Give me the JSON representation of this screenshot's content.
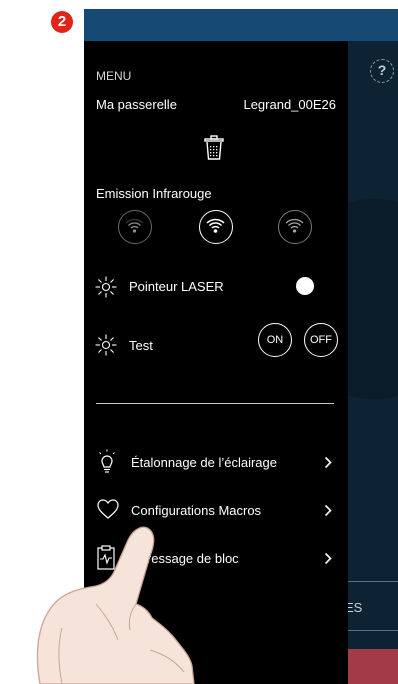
{
  "step_badge": "2",
  "background": {
    "help_symbol": "?",
    "button_partial_label": "ES"
  },
  "menu": {
    "title": "MENU",
    "gateway_label": "Ma passerelle",
    "gateway_value": "Legrand_00E26",
    "trash_icon": "trash-icon",
    "ir": {
      "label": "Emission Infrarouge",
      "levels": [
        "wifi-low-icon",
        "wifi-selected-icon",
        "wifi-high-icon"
      ],
      "selected_index": 1
    },
    "laser": {
      "label": "Pointeur LASER",
      "icon": "laser-sun-icon"
    },
    "test": {
      "label": "Test",
      "on_label": "ON",
      "off_label": "OFF"
    },
    "items": [
      {
        "label": "Étalonnage de l’éclairage",
        "icon": "lightbulb-icon"
      },
      {
        "label": "Configurations Macros",
        "icon": "heart-icon"
      },
      {
        "label": "Adressage de bloc",
        "icon": "clipboard-pulse-icon"
      }
    ]
  },
  "colors": {
    "accent_red": "#e2231a",
    "topbar": "#164a75",
    "drawer": "#000000",
    "bg": "#0d2232"
  }
}
